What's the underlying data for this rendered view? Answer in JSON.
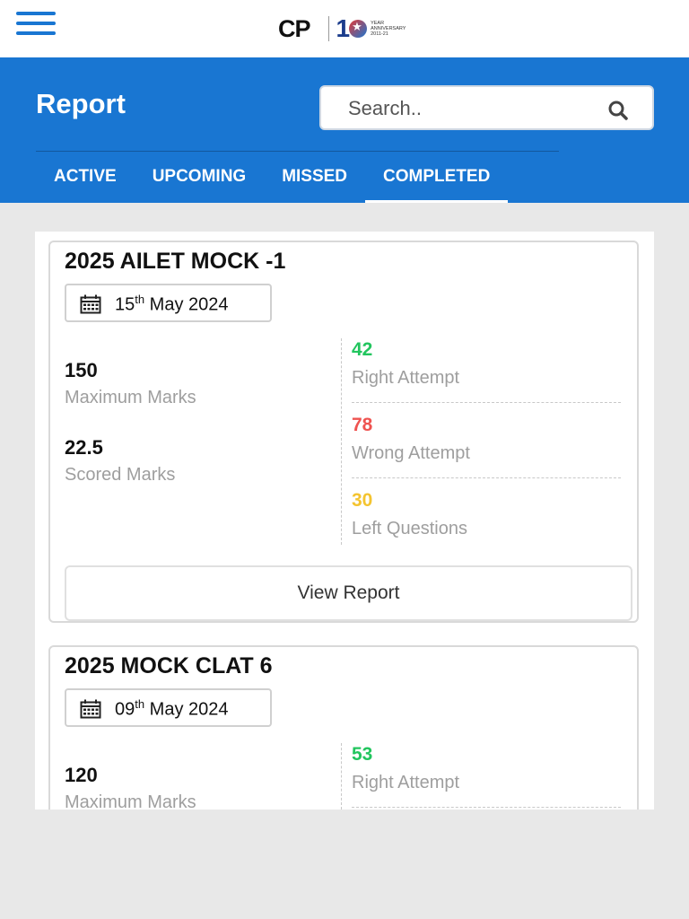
{
  "brand": {
    "logo_text": "CP",
    "anniversary_number": "1",
    "anniversary_text": "YEAR ANNIVERSARY 2011-21"
  },
  "header": {
    "title": "Report",
    "search_placeholder": "Search.."
  },
  "tabs": [
    {
      "label": "ACTIVE",
      "active": false
    },
    {
      "label": "UPCOMING",
      "active": false
    },
    {
      "label": "MISSED",
      "active": false
    },
    {
      "label": "COMPLETED",
      "active": true
    }
  ],
  "colors": {
    "primary": "#1976d2",
    "right": "#22c55e",
    "wrong": "#ef5350",
    "left": "#f4c430"
  },
  "reports": [
    {
      "title": "2025 AILET MOCK -1",
      "date_day": "15",
      "date_suffix": "th",
      "date_rest": "May 2024",
      "max_marks": "150",
      "max_marks_label": "Maximum Marks",
      "scored_marks": "22.5",
      "scored_marks_label": "Scored Marks",
      "right_attempt": "42",
      "right_attempt_label": "Right Attempt",
      "wrong_attempt": "78",
      "wrong_attempt_label": "Wrong Attempt",
      "left_questions": "30",
      "left_questions_label": "Left Questions",
      "button_label": "View Report"
    },
    {
      "title": "2025 MOCK CLAT 6",
      "date_day": "09",
      "date_suffix": "th",
      "date_rest": "May 2024",
      "max_marks": "120",
      "max_marks_label": "Maximum Marks",
      "right_attempt": "53",
      "right_attempt_label": "Right Attempt"
    }
  ]
}
